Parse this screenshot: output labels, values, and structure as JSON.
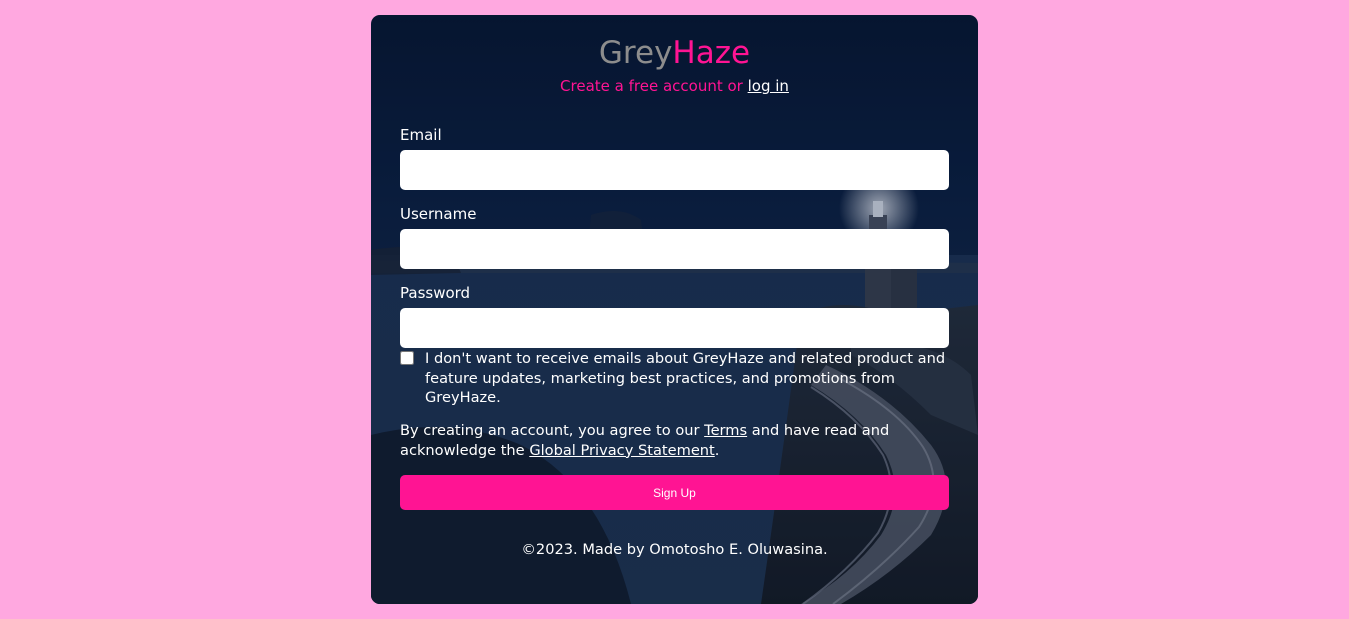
{
  "colors": {
    "page_background": "#ffa8e0",
    "accent": "#ff1493",
    "brand_grey": "#8d8d8d"
  },
  "brand": {
    "part1": "Grey",
    "part2": "Haze"
  },
  "subtitle": {
    "text": "Create a free account or",
    "login_link": "log in"
  },
  "form": {
    "email_label": "Email",
    "email_value": "",
    "username_label": "Username",
    "username_value": "",
    "password_label": "Password",
    "password_value": "",
    "marketing_opt_out_checked": false,
    "marketing_opt_out_text": "I don't want to receive emails about GreyHaze and related product and feature updates, marketing best practices, and promotions from GreyHaze.",
    "terms_prefix": "By creating an account, you agree to our",
    "terms_link": "Terms",
    "terms_middle": "and have read and acknowledge the",
    "privacy_link": "Global Privacy Statement",
    "terms_suffix": ".",
    "signup_label": "Sign Up"
  },
  "footer": {
    "text": "©2023. Made by Omotosho E. Oluwasina."
  }
}
